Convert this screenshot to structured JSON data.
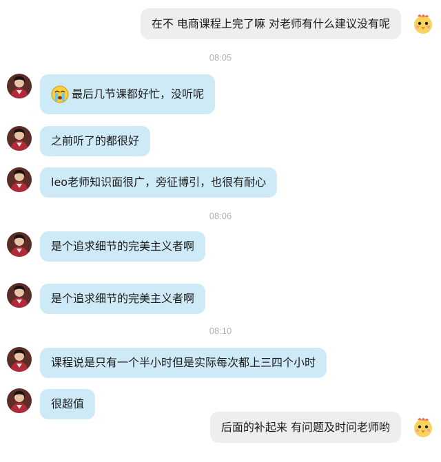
{
  "colors": {
    "incoming_bubble": "#cfeaf7",
    "outgoing_bubble": "#eeeeee",
    "timestamp": "#b0b0b0"
  },
  "messages": [
    {
      "side": "out",
      "text": "在不 电商课程上完了嘛 对老师有什么建议没有呢",
      "avatar_icon": "chick-avatar-icon"
    },
    {
      "type": "timestamp",
      "text": "08:05"
    },
    {
      "side": "in",
      "text": "最后几节课都好忙，没听呢",
      "emoji_icon": "crying-face-emoji-icon"
    },
    {
      "side": "in",
      "text": "之前听了的都很好"
    },
    {
      "side": "in",
      "text": "leo老师知识面很广，旁征博引，也很有耐心"
    },
    {
      "type": "timestamp",
      "text": "08:06"
    },
    {
      "side": "in",
      "text": "是个追求细节的完美主义者啊"
    },
    {
      "side": "in",
      "text": "是个追求细节的完美主义者啊"
    },
    {
      "type": "timestamp",
      "text": "08:10"
    },
    {
      "side": "in",
      "text": "课程说是只有一个半小时但是实际每次都上三四个小时"
    },
    {
      "side": "in",
      "text": "很超值"
    },
    {
      "side": "out",
      "text": "后面的补起来 有问题及时问老师哟",
      "avatar_icon": "chick-avatar-icon"
    }
  ]
}
